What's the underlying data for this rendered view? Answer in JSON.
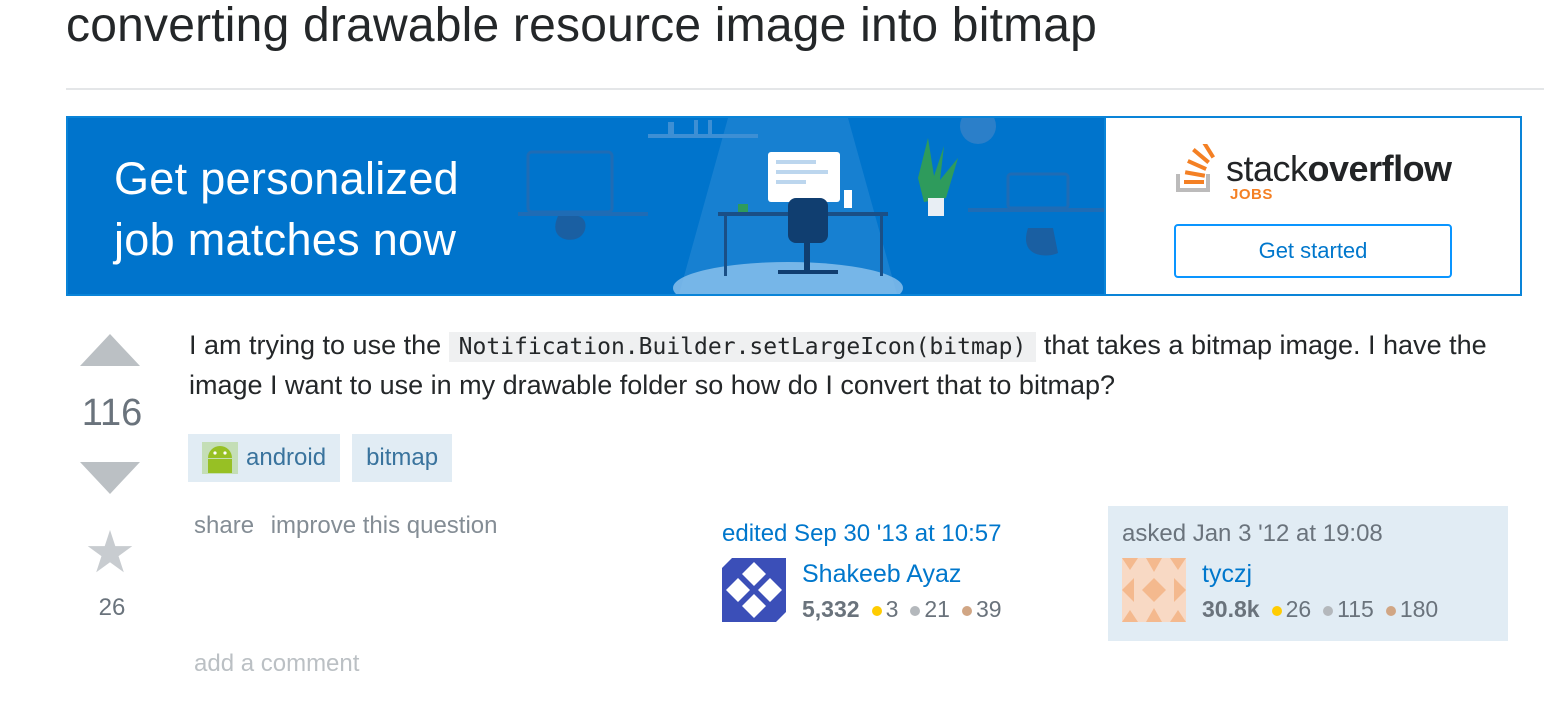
{
  "question": {
    "title": "converting drawable resource image into bitmap",
    "body_before": "I am trying to use the ",
    "body_code": "Notification.Builder.setLargeIcon(bitmap)",
    "body_after": " that takes a bitmap image. I have the image I want to use in my drawable folder so how do I convert that to bitmap?",
    "vote_count": "116",
    "favorite_count": "26",
    "tags": [
      "android",
      "bitmap"
    ]
  },
  "banner": {
    "headline_line1": "Get personalized",
    "headline_line2": "job matches now",
    "logo_word_light": "stack",
    "logo_word_bold": "overflow",
    "logo_sub": "JOBS",
    "cta_label": "Get started",
    "bg_color": "#0074cc"
  },
  "post_menu": {
    "share_label": "share",
    "improve_label": "improve this question"
  },
  "editor": {
    "action_text": "edited Sep 30 '13 at 10:57",
    "name": "Shakeeb Ayaz",
    "reputation": "5,332",
    "gold": "3",
    "silver": "21",
    "bronze": "39"
  },
  "asker": {
    "action_text": "asked Jan 3 '12 at 19:08",
    "name": "tyczj",
    "reputation": "30.8k",
    "gold": "26",
    "silver": "115",
    "bronze": "180"
  },
  "comments": {
    "add_label": "add a comment"
  }
}
